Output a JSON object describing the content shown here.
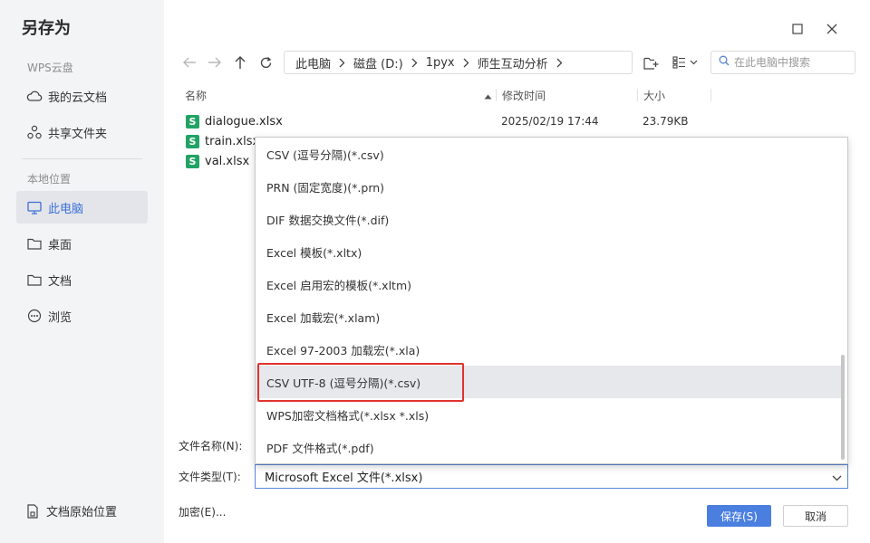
{
  "dialog": {
    "title": "另存为"
  },
  "sidebar": {
    "cloud_section": "WPS云盘",
    "cloud_items": [
      {
        "label": "我的云文档",
        "icon": "cloud-icon"
      },
      {
        "label": "共享文件夹",
        "icon": "share-folder-icon"
      }
    ],
    "local_section": "本地位置",
    "local_items": [
      {
        "label": "此电脑",
        "icon": "computer-icon",
        "active": true
      },
      {
        "label": "桌面",
        "icon": "folder-icon"
      },
      {
        "label": "文档",
        "icon": "folder-icon"
      },
      {
        "label": "浏览",
        "icon": "more-icon"
      }
    ],
    "original_location": "文档原始位置"
  },
  "breadcrumb": [
    "此电脑",
    "磁盘 (D:)",
    "1pyx",
    "师生互动分析"
  ],
  "search": {
    "placeholder": "在此电脑中搜索"
  },
  "columns": {
    "name": "名称",
    "modified": "修改时间",
    "size": "大小"
  },
  "files": [
    {
      "name": "dialogue.xlsx",
      "modified": "2025/02/19 17:44",
      "size": "23.79KB"
    },
    {
      "name": "train.xlsx",
      "modified": "",
      "size": ""
    },
    {
      "name": "val.xlsx",
      "modified": "",
      "size": ""
    }
  ],
  "file_icon_letter": "S",
  "form": {
    "filename_label": "文件名称(N):",
    "filetype_label": "文件类型(T):",
    "filetype_value": "Microsoft Excel 文件(*.xlsx)"
  },
  "dropdown_options": [
    "CSV (逗号分隔)(*.csv)",
    "PRN (固定宽度)(*.prn)",
    "DIF 数据交换文件(*.dif)",
    "Excel 模板(*.xltx)",
    "Excel 启用宏的模板(*.xltm)",
    "Excel 加载宏(*.xlam)",
    "Excel 97-2003 加载宏(*.xla)",
    "CSV UTF-8 (逗号分隔)(*.csv)",
    "WPS加密文档格式(*.xlsx *.xls)",
    "PDF 文件格式(*.pdf)"
  ],
  "highlighted_option": "CSV UTF-8 (逗号分隔)(*.csv)",
  "encrypt_label": "加密(E)...",
  "buttons": {
    "save": "保存(S)",
    "cancel": "取消"
  },
  "colors": {
    "accent": "#4a7fe0",
    "highlight": "#e0332c",
    "excel": "#21a365"
  }
}
